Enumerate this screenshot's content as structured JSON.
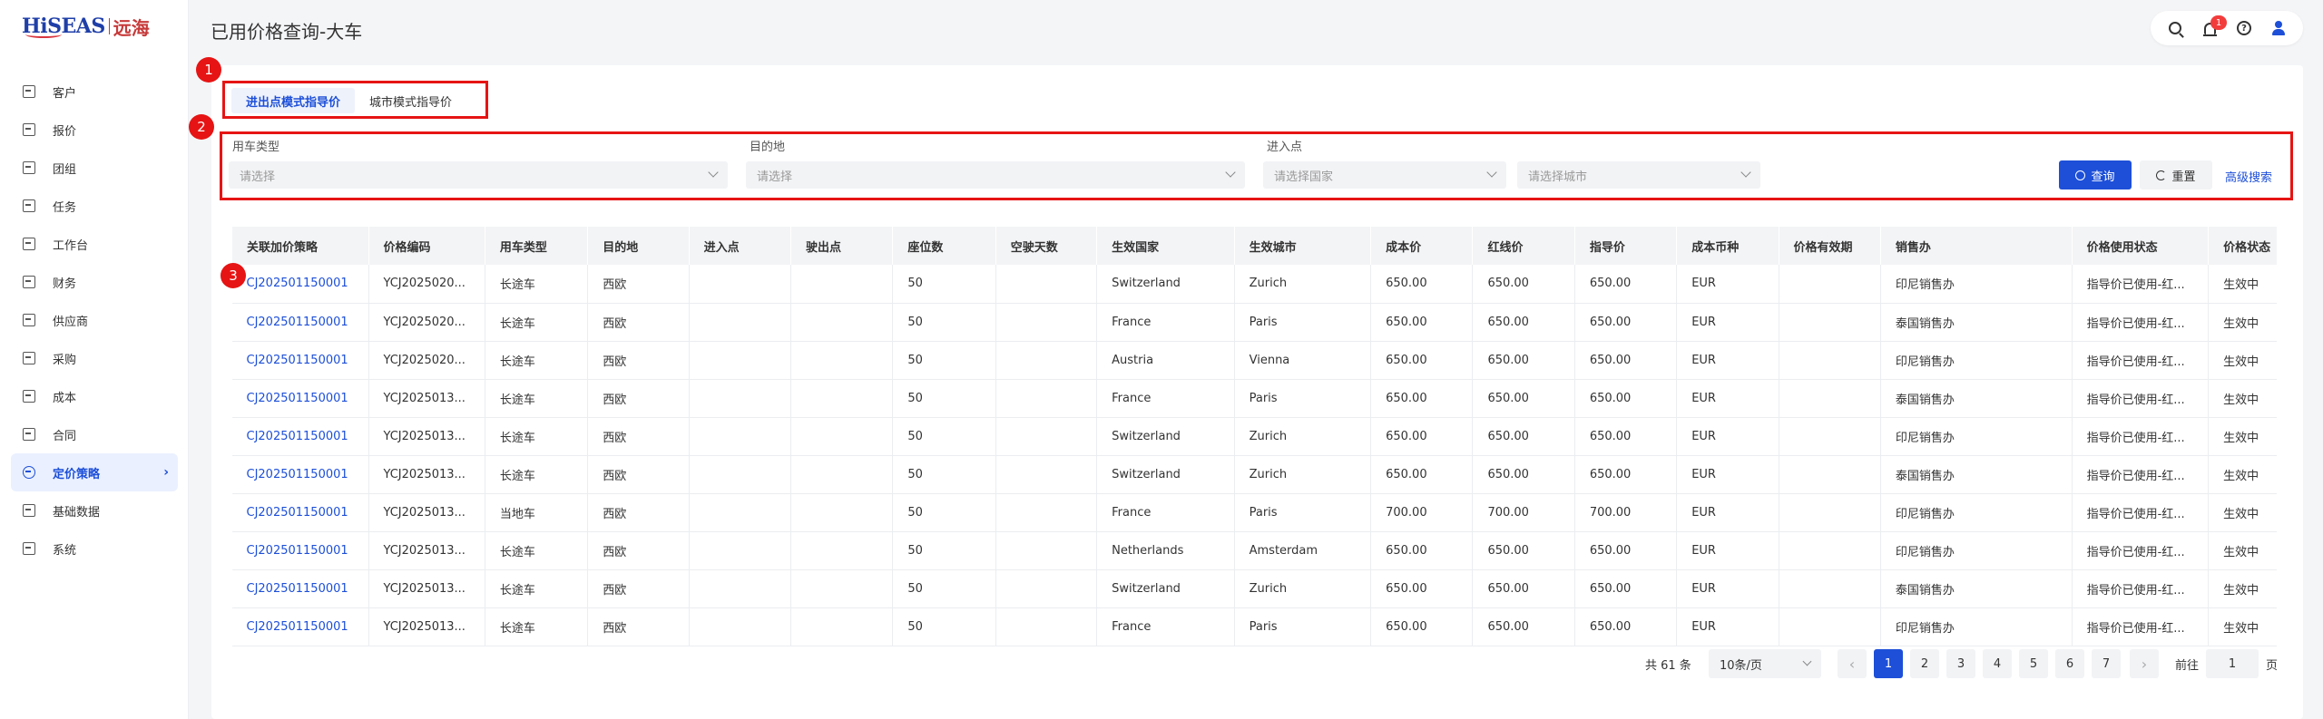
{
  "logo": {
    "main": "HiSEAS",
    "cn": "远海"
  },
  "sidebar": {
    "items": [
      {
        "label": "客户",
        "icon": "customer-icon"
      },
      {
        "label": "报价",
        "icon": "quote-icon"
      },
      {
        "label": "团组",
        "icon": "group-icon"
      },
      {
        "label": "任务",
        "icon": "task-icon"
      },
      {
        "label": "工作台",
        "icon": "workbench-icon"
      },
      {
        "label": "财务",
        "icon": "finance-icon"
      },
      {
        "label": "供应商",
        "icon": "supplier-icon"
      },
      {
        "label": "采购",
        "icon": "purchase-icon"
      },
      {
        "label": "成本",
        "icon": "cost-icon"
      },
      {
        "label": "合同",
        "icon": "contract-icon"
      },
      {
        "label": "定价策略",
        "icon": "pricing-icon",
        "active": true
      },
      {
        "label": "基础数据",
        "icon": "base-data-icon"
      },
      {
        "label": "系统",
        "icon": "system-icon"
      }
    ]
  },
  "header": {
    "title": "已用价格查询-大车",
    "notification_count": "1",
    "help_glyph": "?"
  },
  "annotations": {
    "a1": "1",
    "a2": "2",
    "a3": "3"
  },
  "tabs": {
    "t1": "进出点模式指导价",
    "t2": "城市模式指导价"
  },
  "filter": {
    "vehicle_type_label": "用车类型",
    "vehicle_type_placeholder": "请选择",
    "destination_label": "目的地",
    "destination_placeholder": "请选择",
    "entry_label": "进入点",
    "entry_country_placeholder": "请选择国家",
    "entry_city_placeholder": "请选择城市",
    "query": "查询",
    "reset": "重置",
    "advanced": "高级搜索"
  },
  "table": {
    "headers": [
      "关联加价策略",
      "价格编码",
      "用车类型",
      "目的地",
      "进入点",
      "驶出点",
      "座位数",
      "空驶天数",
      "生效国家",
      "生效城市",
      "成本价",
      "红线价",
      "指导价",
      "成本币种",
      "价格有效期",
      "销售办",
      "价格使用状态",
      "价格状态"
    ],
    "rows": [
      [
        "CJ202501150001",
        "YCJ2025020...",
        "长途车",
        "西欧",
        "",
        "",
        "50",
        "",
        "Switzerland",
        "Zurich",
        "650.00",
        "650.00",
        "650.00",
        "EUR",
        "",
        "印尼销售办",
        "指导价已使用-红...",
        "生效中"
      ],
      [
        "CJ202501150001",
        "YCJ2025020...",
        "长途车",
        "西欧",
        "",
        "",
        "50",
        "",
        "France",
        "Paris",
        "650.00",
        "650.00",
        "650.00",
        "EUR",
        "",
        "泰国销售办",
        "指导价已使用-红...",
        "生效中"
      ],
      [
        "CJ202501150001",
        "YCJ2025020...",
        "长途车",
        "西欧",
        "",
        "",
        "50",
        "",
        "Austria",
        "Vienna",
        "650.00",
        "650.00",
        "650.00",
        "EUR",
        "",
        "印尼销售办",
        "指导价已使用-红...",
        "生效中"
      ],
      [
        "CJ202501150001",
        "YCJ2025013...",
        "长途车",
        "西欧",
        "",
        "",
        "50",
        "",
        "France",
        "Paris",
        "650.00",
        "650.00",
        "650.00",
        "EUR",
        "",
        "泰国销售办",
        "指导价已使用-红...",
        "生效中"
      ],
      [
        "CJ202501150001",
        "YCJ2025013...",
        "长途车",
        "西欧",
        "",
        "",
        "50",
        "",
        "Switzerland",
        "Zurich",
        "650.00",
        "650.00",
        "650.00",
        "EUR",
        "",
        "印尼销售办",
        "指导价已使用-红...",
        "生效中"
      ],
      [
        "CJ202501150001",
        "YCJ2025013...",
        "长途车",
        "西欧",
        "",
        "",
        "50",
        "",
        "Switzerland",
        "Zurich",
        "650.00",
        "650.00",
        "650.00",
        "EUR",
        "",
        "泰国销售办",
        "指导价已使用-红...",
        "生效中"
      ],
      [
        "CJ202501150001",
        "YCJ2025013...",
        "当地车",
        "西欧",
        "",
        "",
        "50",
        "",
        "France",
        "Paris",
        "700.00",
        "700.00",
        "700.00",
        "EUR",
        "",
        "印尼销售办",
        "指导价已使用-红...",
        "生效中"
      ],
      [
        "CJ202501150001",
        "YCJ2025013...",
        "长途车",
        "西欧",
        "",
        "",
        "50",
        "",
        "Netherlands",
        "Amsterdam",
        "650.00",
        "650.00",
        "650.00",
        "EUR",
        "",
        "印尼销售办",
        "指导价已使用-红...",
        "生效中"
      ],
      [
        "CJ202501150001",
        "YCJ2025013...",
        "长途车",
        "西欧",
        "",
        "",
        "50",
        "",
        "Switzerland",
        "Zurich",
        "650.00",
        "650.00",
        "650.00",
        "EUR",
        "",
        "泰国销售办",
        "指导价已使用-红...",
        "生效中"
      ],
      [
        "CJ202501150001",
        "YCJ2025013...",
        "长途车",
        "西欧",
        "",
        "",
        "50",
        "",
        "France",
        "Paris",
        "650.00",
        "650.00",
        "650.00",
        "EUR",
        "",
        "印尼销售办",
        "指导价已使用-红...",
        "生效中"
      ]
    ]
  },
  "pagination": {
    "total": "共 61 条",
    "page_size": "10条/页",
    "prev": "‹",
    "next": "›",
    "pages": [
      "1",
      "2",
      "3",
      "4",
      "5",
      "6",
      "7"
    ],
    "current": "1",
    "goto_label": "前往",
    "goto_value": "1",
    "goto_suffix": "页"
  },
  "colors": {
    "accent": "#1d4fd8",
    "annotation": "#e61414"
  }
}
